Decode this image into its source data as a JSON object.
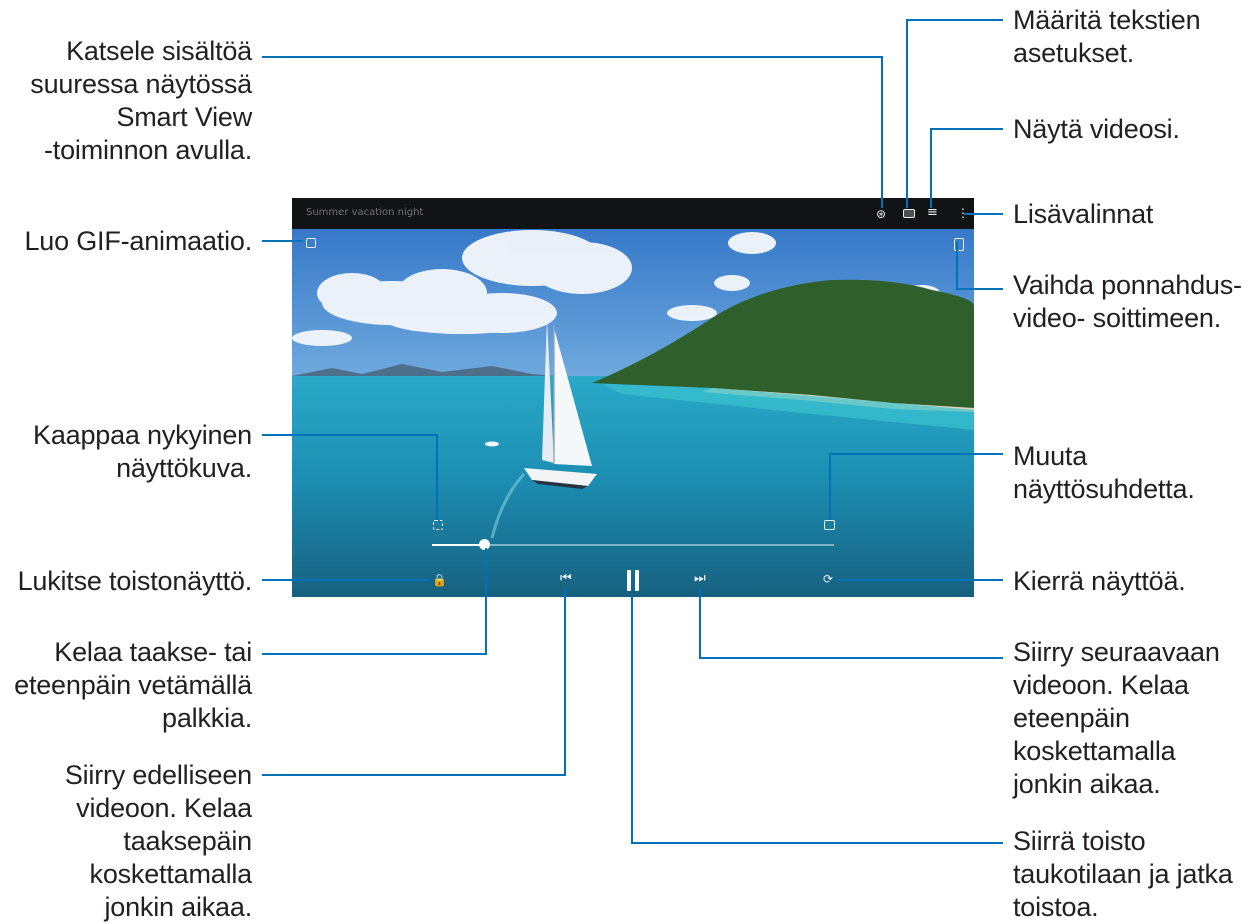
{
  "video": {
    "title_text": "Summer vacation night",
    "progress_fraction": 0.13
  },
  "callouts": {
    "smart_view": "Katsele sisältöä\nsuuressa näytössä\nSmart View\n-toiminnon avulla.",
    "gif": "Luo GIF-animaatio.",
    "capture": "Kaappaa nykyinen\nnäyttökuva.",
    "lock": "Lukitse toistonäyttö.",
    "seek": "Kelaa taakse- tai\neteenpäin vetämällä\npalkkia.",
    "previous": "Siirry edelliseen\nvideoon. Kelaa\ntaaksepäin\nkoskettamalla\njonkin aikaa.",
    "subtitles": "Määritä tekstien\nasetukset.",
    "my_videos": "Näytä videosi.",
    "more_options": "Lisävalinnat",
    "popup": "Vaihda ponnahdus-\nvideo- soittimeen.",
    "ratio": "Muuta\nnäyttösuhdetta.",
    "rotate": "Kierrä näyttöä.",
    "next": "Siirry seuraavaan\nvideoon. Kelaa\neteenpäin\nkoskettamalla\njonkin aikaa.",
    "pause": "Siirrä toisto\ntaukotilaan ja jatka\ntoistoa."
  },
  "icons": {
    "smart_view": "smart-view-icon",
    "subtitles": "subtitles-icon",
    "my_videos": "video-list-icon",
    "more": "more-options-icon",
    "gif": "gif-icon",
    "popup": "popup-player-icon",
    "capture": "capture-icon",
    "ratio": "aspect-ratio-icon",
    "lock": "lock-icon",
    "previous": "previous-icon",
    "pause": "pause-icon",
    "next": "next-icon",
    "rotate": "rotate-icon"
  },
  "colors": {
    "leader_line": "#0072bc",
    "text": "#231f20",
    "top_bar": "#111315"
  }
}
